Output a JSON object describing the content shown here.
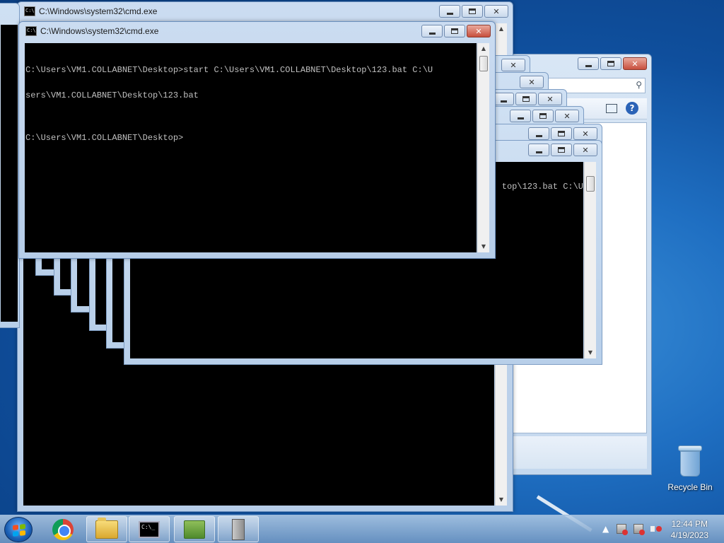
{
  "window": {
    "title": "C:\\Windows\\system32\\cmd.exe",
    "icon_text": "C:\\"
  },
  "console": {
    "lines": [
      "C:\\Users\\VM1.COLLABNET\\Desktop>start C:\\Users\\VM1.COLLABNET\\Desktop\\123.bat C:\\U",
      "sers\\VM1.COLLABNET\\Desktop\\123.bat",
      "",
      "C:\\Users\\VM1.COLLABNET\\Desktop>"
    ]
  },
  "cascade": {
    "partial_text": "top\\123.bat C:\\U"
  },
  "desktop": {
    "recycle_bin_label": "Recycle Bin"
  },
  "taskbar": {
    "cmd_icon_text": "C:\\_",
    "time": "12:44 PM",
    "date": "4/19/2023"
  },
  "colors": {
    "console_bg": "#000000",
    "console_fg": "#c0c0c0",
    "close_red": "#c84f3d",
    "frame_blue": "#b8cfe9"
  }
}
